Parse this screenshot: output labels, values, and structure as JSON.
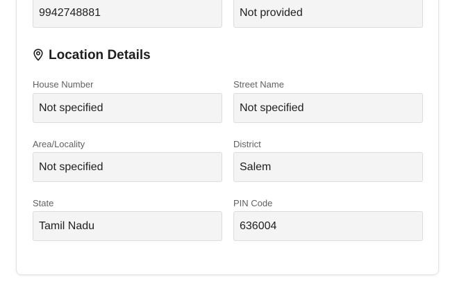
{
  "contact": {
    "phone_value": "9942748881",
    "alt_value": "Not provided"
  },
  "location": {
    "section_icon": "map-pin-icon",
    "title": "Location Details",
    "house_number": {
      "label": "House Number",
      "value": "Not specified"
    },
    "street_name": {
      "label": "Street Name",
      "value": "Not specified"
    },
    "area": {
      "label": "Area/Locality",
      "value": "Not specified"
    },
    "district": {
      "label": "District",
      "value": "Salem"
    },
    "state": {
      "label": "State",
      "value": "Tamil Nadu"
    },
    "pin_code": {
      "label": "PIN Code",
      "value": "636004"
    }
  },
  "colors": {
    "field_bg": "#f4f4f4",
    "field_border": "#dcdcdc",
    "label_text": "#616161",
    "value_text": "#1e1e1e"
  }
}
